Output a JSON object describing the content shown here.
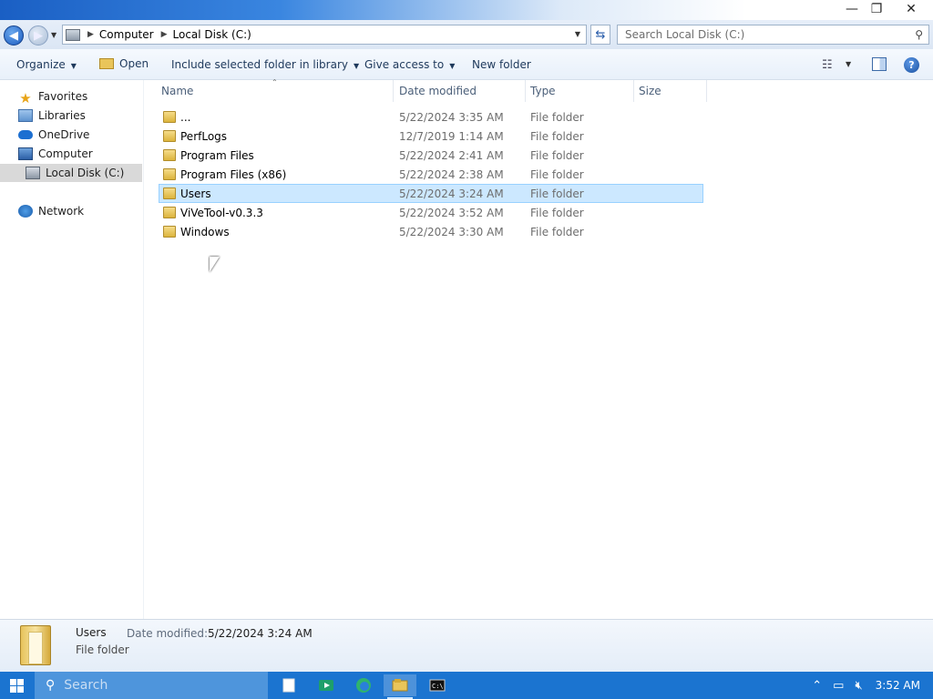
{
  "window": {
    "minimize": "—",
    "maximize": "❐",
    "close": "✕"
  },
  "address": {
    "crumbs": [
      "Computer",
      "Local Disk (C:)"
    ],
    "search_placeholder": "Search Local Disk (C:)"
  },
  "toolbar": {
    "organize": "Organize",
    "open": "Open",
    "include": "Include selected folder in library",
    "share": "Give access to",
    "new_folder": "New folder"
  },
  "nav": {
    "favorites": "Favorites",
    "libraries": "Libraries",
    "onedrive": "OneDrive",
    "computer": "Computer",
    "local_disk": "Local Disk (C:)",
    "network": "Network"
  },
  "columns": {
    "name": "Name",
    "date": "Date modified",
    "type": "Type",
    "size": "Size"
  },
  "files": [
    {
      "name": "...",
      "date": "5/22/2024 3:35 AM",
      "type": "File folder",
      "selected": false
    },
    {
      "name": "PerfLogs",
      "date": "12/7/2019 1:14 AM",
      "type": "File folder",
      "selected": false
    },
    {
      "name": "Program Files",
      "date": "5/22/2024 2:41 AM",
      "type": "File folder",
      "selected": false
    },
    {
      "name": "Program Files (x86)",
      "date": "5/22/2024 2:38 AM",
      "type": "File folder",
      "selected": false
    },
    {
      "name": "Users",
      "date": "5/22/2024 3:24 AM",
      "type": "File folder",
      "selected": true
    },
    {
      "name": "ViVeTool-v0.3.3",
      "date": "5/22/2024 3:52 AM",
      "type": "File folder",
      "selected": false
    },
    {
      "name": "Windows",
      "date": "5/22/2024 3:30 AM",
      "type": "File folder",
      "selected": false
    }
  ],
  "details": {
    "name": "Users",
    "date_label": "Date modified:",
    "date_value": "5/22/2024 3:24 AM",
    "type": "File folder"
  },
  "taskbar": {
    "search_placeholder": "Search",
    "clock": "3:52 AM",
    "accent": "#1b74d0"
  }
}
